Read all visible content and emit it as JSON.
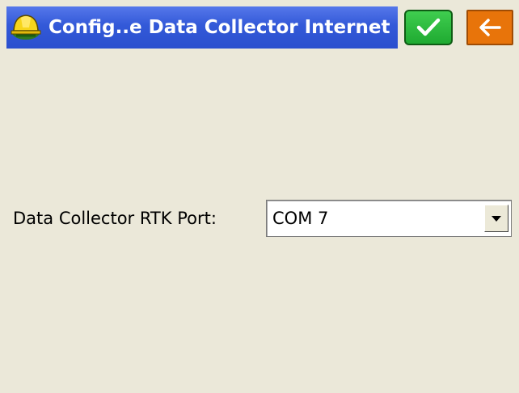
{
  "window": {
    "title": "Config..e Data Collector Internet",
    "title_bar_color": "#3359d8"
  },
  "toolbar": {
    "ok_icon": "checkmark-icon",
    "ok_color": "#2fbf3f",
    "back_icon": "arrow-left-icon",
    "back_color": "#e8740a"
  },
  "form": {
    "rtk_port_label": "Data Collector RTK Port:",
    "rtk_port_value": "COM 7"
  }
}
